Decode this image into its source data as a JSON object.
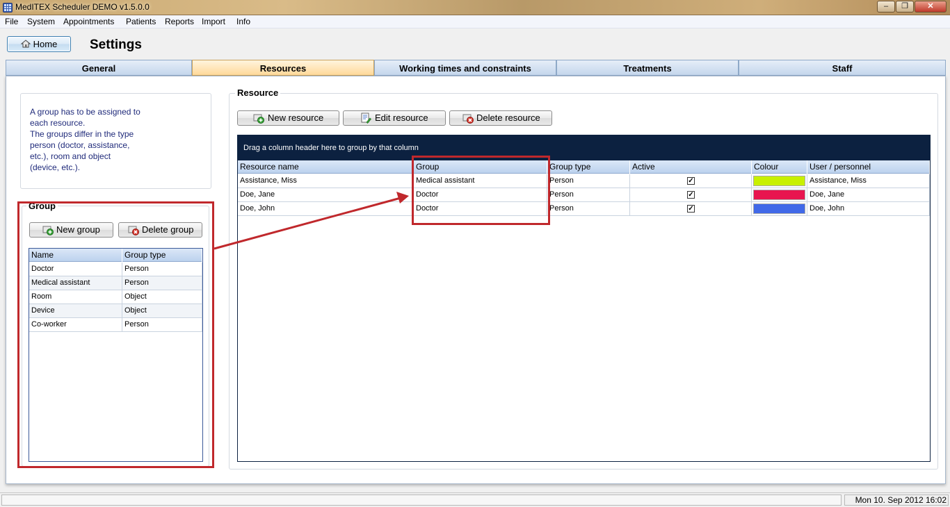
{
  "window": {
    "title": "MedITEX  Scheduler DEMO v1.5.0.0",
    "controls": [
      "–",
      "❐",
      "✕"
    ]
  },
  "menu": [
    "File",
    "System",
    "Appointments",
    "Patients",
    "Reports",
    "Import",
    "Info"
  ],
  "header": {
    "home_label": "Home",
    "page_title": "Settings"
  },
  "tabs": [
    "General",
    "Resources",
    "Working times and constraints",
    "Treatments",
    "Staff"
  ],
  "active_tab": "Resources",
  "info_text": [
    "A group has to be assigned to",
    "each resource.",
    "The groups differ in the type",
    "person (doctor, assistance,",
    "etc.), room and object",
    "(device, etc.)."
  ],
  "group_panel": {
    "legend": "Group",
    "new_label": "New group",
    "delete_label": "Delete group",
    "columns": [
      "Name",
      "Group type"
    ],
    "rows": [
      [
        "Doctor",
        "Person"
      ],
      [
        "Medical assistant",
        "Person"
      ],
      [
        "Room",
        "Object"
      ],
      [
        "Device",
        "Object"
      ],
      [
        "Co-worker",
        "Person"
      ]
    ]
  },
  "resource_panel": {
    "legend": "Resource",
    "new_label": "New resource",
    "edit_label": "Edit resource",
    "delete_label": "Delete resource",
    "group_hint": "Drag a column header here to group by that column",
    "columns": [
      "Resource name",
      "Group",
      "Group type",
      "Active",
      "Colour",
      "User / personnel"
    ],
    "rows": [
      {
        "name": "Assistance, Miss",
        "group": "Medical assistant",
        "type": "Person",
        "active": true,
        "colour": "#c8f000",
        "user": "Assistance, Miss"
      },
      {
        "name": "Doe, Jane",
        "group": "Doctor",
        "type": "Person",
        "active": true,
        "colour": "#e8154f",
        "user": "Doe, Jane"
      },
      {
        "name": "Doe, John",
        "group": "Doctor",
        "type": "Person",
        "active": true,
        "colour": "#4169e8",
        "user": "Doe, John"
      }
    ]
  },
  "status": {
    "datetime": "Mon 10. Sep 2012 16:02"
  },
  "colors": {
    "annotation": "#c0282c",
    "active_tab": "#ffd99a",
    "group_bar": "#0c2140"
  }
}
